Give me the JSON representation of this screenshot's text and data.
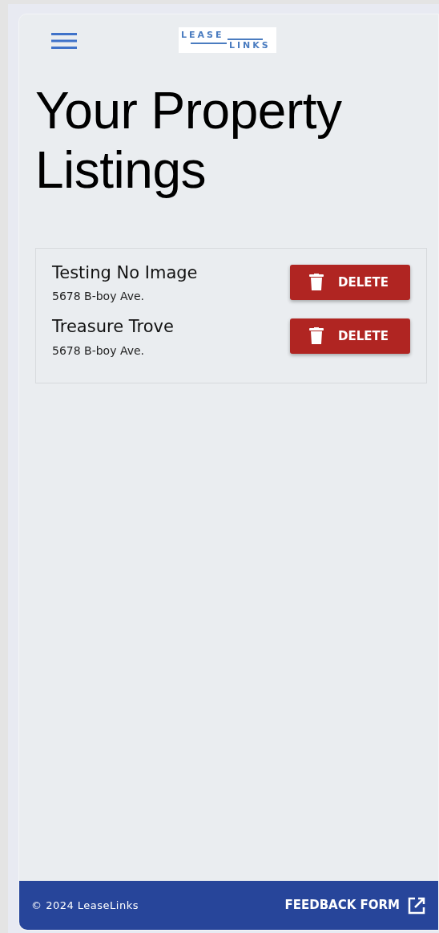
{
  "header": {
    "logo": {
      "top": "LEASE",
      "bottom": "LINKS"
    }
  },
  "title": "Your Property Listings",
  "listings": [
    {
      "name": "Testing No Image",
      "address": "5678 B-boy Ave.",
      "action": "DELETE"
    },
    {
      "name": "Treasure Trove",
      "address": "5678 B-boy Ave.",
      "action": "DELETE"
    }
  ],
  "footer": {
    "copyright": "© 2024 LeaseLinks",
    "link": "FEEDBACK FORM"
  }
}
